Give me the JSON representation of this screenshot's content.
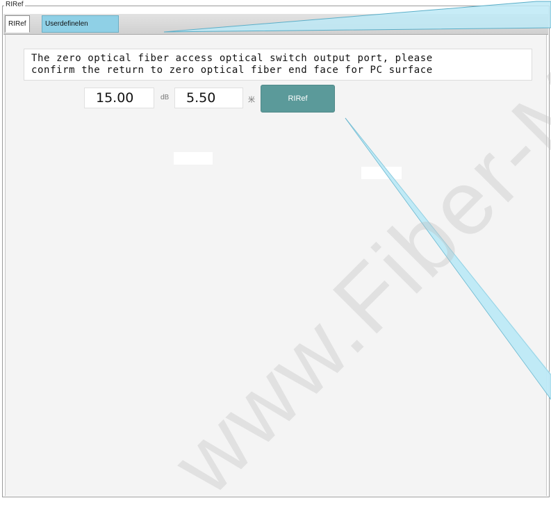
{
  "groupbox": {
    "title": "RIRef"
  },
  "tabs": [
    {
      "label": "RIRef",
      "active": true
    },
    {
      "label": "Userdefinelen",
      "active": false
    }
  ],
  "message": {
    "line1": "The zero optical fiber access optical switch output port, please",
    "line2": "confirm the return to zero optical fiber end face for PC surface"
  },
  "fields": {
    "loss_value": "15.00",
    "loss_unit": "dB",
    "length_value": "5.50",
    "length_unit": "米"
  },
  "buttons": {
    "riref_label": "RIRef"
  },
  "watermark": "www.Fiber-Ma",
  "colors": {
    "tab_inactive": "#8fd0e6",
    "button_bg": "#5b9a9a",
    "callout": "#bde9f6"
  }
}
